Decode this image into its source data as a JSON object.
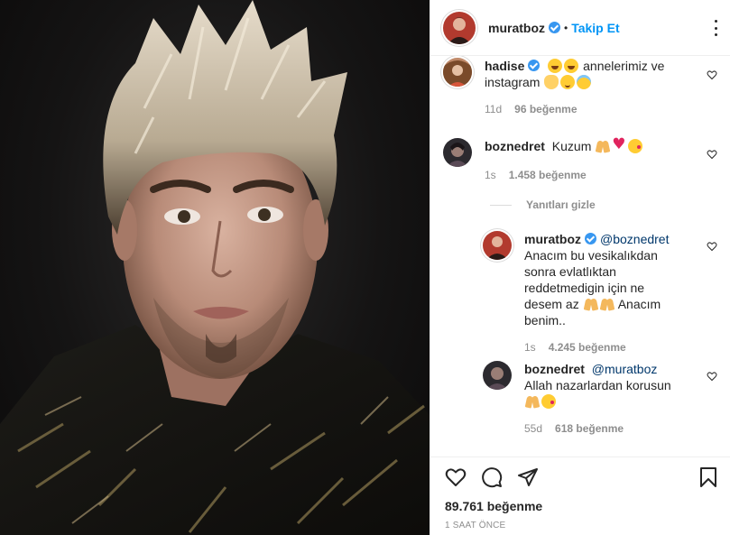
{
  "post": {
    "author": "muratboz",
    "verified": true,
    "separator": "•",
    "follow_label": "Takip Et",
    "likes_label": "89.761 beğenme",
    "time_label": "1 SAAT ÖNCE"
  },
  "comments": [
    {
      "user": "hadise",
      "verified": true,
      "text_a": "annelerimiz ve",
      "text_b": "instagram",
      "age": "11d",
      "likes": "96 beğenme"
    },
    {
      "user": "boznedret",
      "verified": false,
      "text": "Kuzum",
      "age": "1s",
      "likes": "1.458 beğenme"
    }
  ],
  "replies_toggle": "Yanıtları gizle",
  "replies": [
    {
      "user": "muratboz",
      "verified": true,
      "mention": "@boznedret",
      "lines": [
        "Anacım bu vesikalıkdan",
        "sonra evlatlıktan",
        "reddetmedigin için ne",
        "desem az"
      ],
      "tail": "Anacım",
      "last": "benim..",
      "age": "1s",
      "likes": "4.245 beğenme"
    },
    {
      "user": "boznedret",
      "verified": false,
      "mention": "@muratboz",
      "line1": "Allah nazarlardan korusun",
      "age": "55d",
      "likes": "618 beğenme"
    }
  ],
  "icons": {
    "like": "heart-icon",
    "comment": "comment-icon",
    "share": "paper-plane-icon",
    "save": "bookmark-icon",
    "options": "more-options-icon"
  },
  "colors": {
    "accent": "#0095f6",
    "verified": "#3897f0",
    "muted": "#8e8e8e",
    "text": "#262626",
    "border": "#efefef"
  }
}
